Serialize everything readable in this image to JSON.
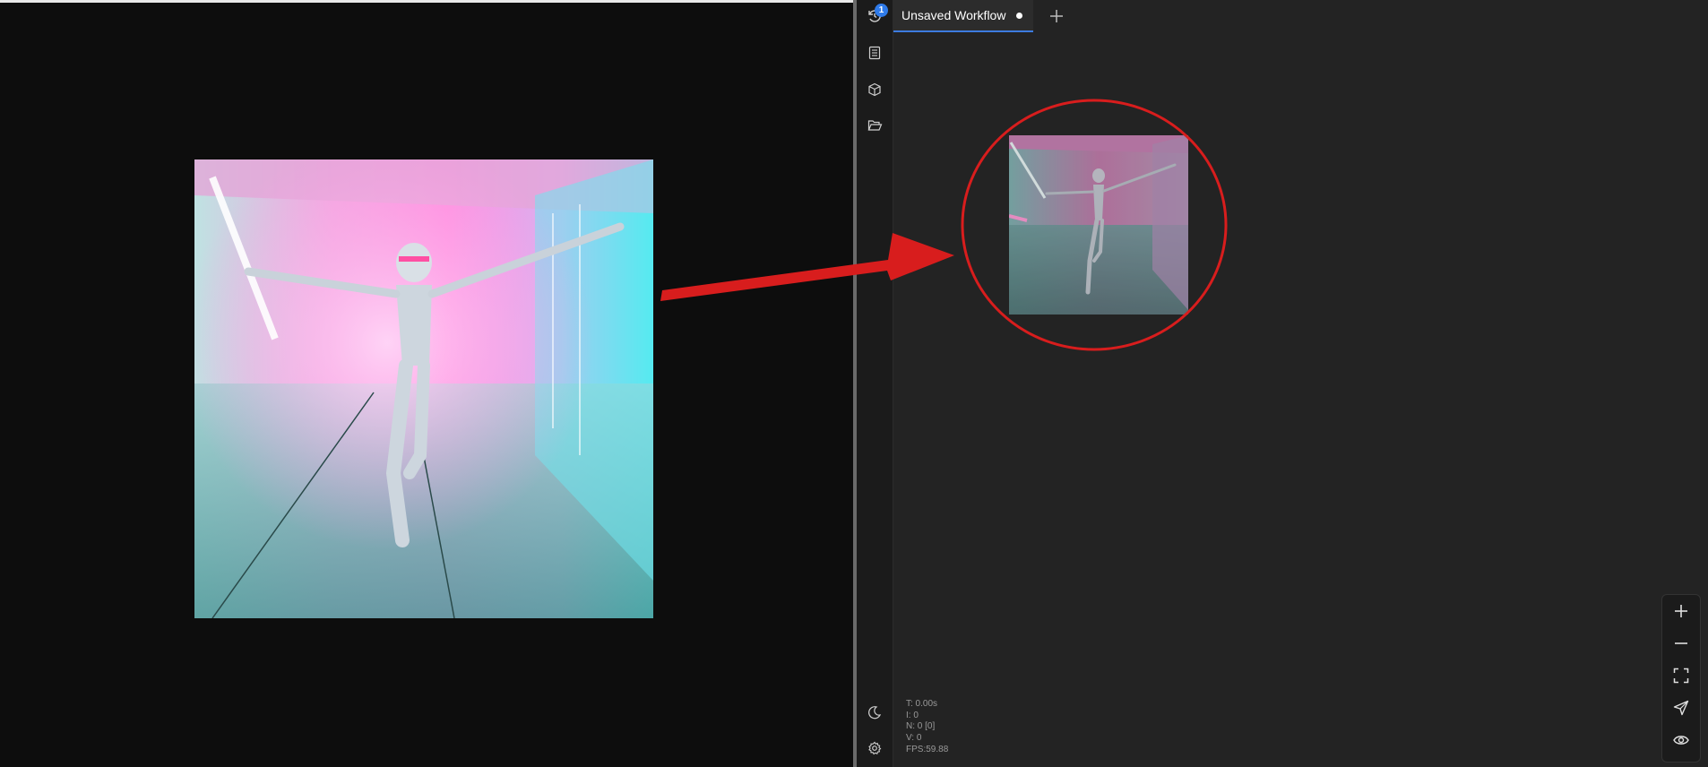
{
  "tab": {
    "title": "Unsaved Workflow"
  },
  "stats": {
    "time": "T: 0.00s",
    "iterations": "I: 0",
    "nodes": "N: 0 [0]",
    "vertices": "V: 0",
    "fps": "FPS:59.88"
  },
  "queue_badge": "1",
  "colors": {
    "accent": "#3d7be0",
    "badge": "#2f7bea",
    "annotation": "#d81d1d",
    "canvas": "#232323",
    "sidebar": "#1b1b1b"
  },
  "icons": {
    "sidebar": [
      "queue-history-icon",
      "document-icon",
      "cube-icon",
      "folder-open-icon",
      "moon-icon",
      "gear-icon"
    ],
    "zoom": [
      "plus-icon",
      "minus-icon",
      "fit-view-icon",
      "navigate-icon",
      "eye-icon"
    ]
  }
}
